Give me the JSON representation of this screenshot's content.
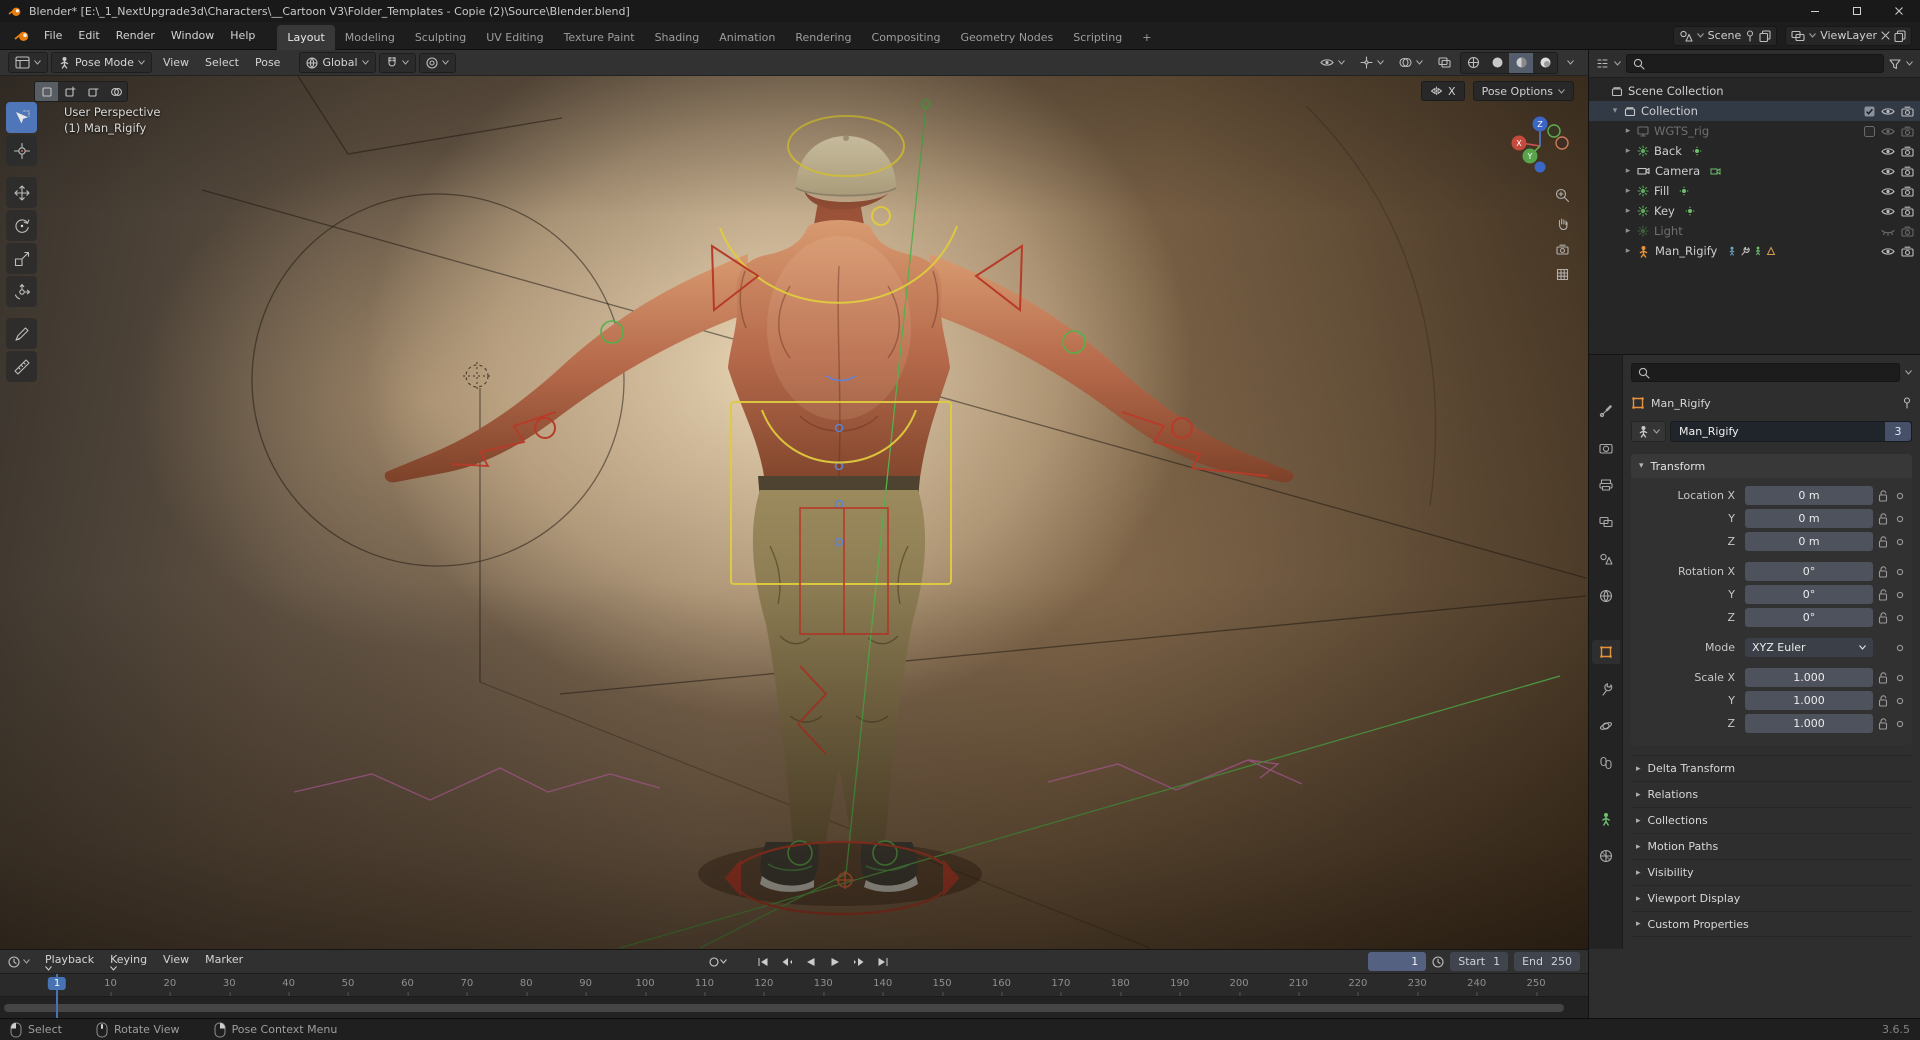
{
  "colors": {
    "accent_blue": "#4772b3",
    "rig_yellow": "#e0cb3e",
    "rig_red": "#b83a28",
    "rig_green": "#55b04b",
    "rig_pink": "#d06cb4",
    "rig_blue": "#5d83d6",
    "skin_light": "#d89a70",
    "skin_dark": "#7c4229",
    "pants_light": "#9b8a5d",
    "pants_dark": "#6b5c3c",
    "cap": "#d6caa8"
  },
  "window": {
    "title": "Blender* [E:\\_1_NextUpgrade3d\\Characters\\__Cartoon V3\\Folder_Templates - Copie (2)\\Source\\Blender.blend]"
  },
  "topbar": {
    "menus": [
      "File",
      "Edit",
      "Render",
      "Window",
      "Help"
    ],
    "workspaces": [
      "Layout",
      "Modeling",
      "Sculpting",
      "UV Editing",
      "Texture Paint",
      "Shading",
      "Animation",
      "Rendering",
      "Compositing",
      "Geometry Nodes",
      "Scripting"
    ],
    "active_workspace": "Layout",
    "add_tab": "+",
    "scene_label": "Scene",
    "view_layer_label": "ViewLayer"
  },
  "viewport": {
    "mode": "Pose Mode",
    "menus": [
      "View",
      "Select",
      "Pose"
    ],
    "orientation": "Global",
    "mirror_x": "X",
    "pose_options": "Pose Options",
    "overlay_line1": "User Perspective",
    "overlay_line2": "(1) Man_Rigify",
    "axis": {
      "x": "X",
      "y": "Y",
      "z": "Z"
    },
    "tools": [
      "select-box",
      "cursor",
      "move",
      "rotate",
      "scale",
      "transform",
      "annotate",
      "measure"
    ]
  },
  "outliner": {
    "root": "Scene Collection",
    "items": [
      {
        "name": "Collection",
        "icon": "collection",
        "level": 1,
        "arrow": "down",
        "checkbox": true,
        "eye": "open",
        "camera": true,
        "highlight": true
      },
      {
        "name": "WGTS_rig",
        "icon": "screen",
        "level": 2,
        "arrow": "right",
        "grayed": true,
        "checkbox": false,
        "eye": "open",
        "camera": true,
        "dim_icons": true
      },
      {
        "name": "Back",
        "icon": "light",
        "level": 2,
        "arrow": "right",
        "inline": [
          "light-data"
        ],
        "eye": "open",
        "camera": true
      },
      {
        "name": "Camera",
        "icon": "camera-obj",
        "level": 2,
        "arrow": "right",
        "inline": [
          "camera-data"
        ],
        "eye": "open",
        "camera": true
      },
      {
        "name": "Fill",
        "icon": "light",
        "level": 2,
        "arrow": "right",
        "inline": [
          "light-data"
        ],
        "eye": "open",
        "camera": true
      },
      {
        "name": "Key",
        "icon": "light",
        "level": 2,
        "arrow": "right",
        "inline": [
          "light-data"
        ],
        "eye": "open",
        "camera": true
      },
      {
        "name": "Light",
        "icon": "light",
        "level": 2,
        "arrow": "right",
        "grayed": true,
        "eye": "closed",
        "camera": true,
        "dim_icons": true
      },
      {
        "name": "Man_Rigify",
        "icon": "armature",
        "level": 2,
        "arrow": "right",
        "inline": [
          "pose",
          "modifier",
          "armature-data",
          "mesh-data"
        ],
        "eye": "open",
        "camera": true
      }
    ]
  },
  "properties": {
    "tabs": [
      {
        "name": "tool"
      },
      {
        "name": "render"
      },
      {
        "name": "output"
      },
      {
        "name": "view-layer"
      },
      {
        "name": "scene"
      },
      {
        "name": "world"
      },
      {
        "name": "object",
        "active": true
      },
      {
        "name": "modifiers"
      },
      {
        "name": "physics"
      },
      {
        "name": "constraints"
      },
      {
        "name": "object-data",
        "green": true
      },
      {
        "name": "texture"
      }
    ],
    "breadcrumb": "Man_Rigify",
    "name_value": "Man_Rigify",
    "users_count": "3",
    "transform_title": "Transform",
    "transform_rows": [
      {
        "label": "Location X",
        "value": "0 m",
        "kind": "number"
      },
      {
        "label": "Y",
        "value": "0 m",
        "kind": "number"
      },
      {
        "label": "Z",
        "value": "0 m",
        "kind": "number"
      },
      {
        "label": "Rotation X",
        "value": "0°",
        "kind": "number",
        "group_start": true
      },
      {
        "label": "Y",
        "value": "0°",
        "kind": "number"
      },
      {
        "label": "Z",
        "value": "0°",
        "kind": "number"
      },
      {
        "label": "Mode",
        "value": "XYZ Euler",
        "kind": "dropdown",
        "group_start": true
      },
      {
        "label": "Scale X",
        "value": "1.000",
        "kind": "number",
        "group_start": true
      },
      {
        "label": "Y",
        "value": "1.000",
        "kind": "number"
      },
      {
        "label": "Z",
        "value": "1.000",
        "kind": "number"
      }
    ],
    "panels": [
      "Delta Transform",
      "Relations",
      "Collections",
      "Motion Paths",
      "Visibility",
      "Viewport Display",
      "Custom Properties"
    ]
  },
  "timeline": {
    "menus": [
      "Playback",
      "Keying",
      "View",
      "Marker"
    ],
    "current_frame": "1",
    "start_label": "Start",
    "start_value": "1",
    "end_label": "End",
    "end_value": "250",
    "ticks": [
      10,
      20,
      30,
      40,
      50,
      60,
      70,
      80,
      90,
      100,
      110,
      120,
      130,
      140,
      150,
      160,
      170,
      180,
      190,
      200,
      210,
      220,
      230,
      240,
      250
    ]
  },
  "statusbar": {
    "hints": [
      {
        "icon": "mouse-left",
        "label": "Select"
      },
      {
        "icon": "mouse-middle",
        "label": "Rotate View"
      },
      {
        "icon": "mouse-right",
        "label": "Pose Context Menu"
      }
    ],
    "version": "3.6.5"
  }
}
